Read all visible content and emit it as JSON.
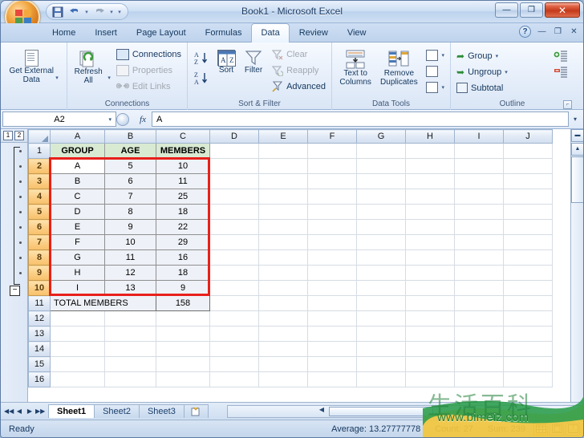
{
  "window": {
    "title": "Book1 - Microsoft Excel",
    "minimize_label": "—",
    "restore_label": "❐",
    "close_label": "✕"
  },
  "quick_access": {
    "office_button": "Office Button",
    "save_label": "💾",
    "undo_label": "↶",
    "redo_label": "↷",
    "customize_label": "▾"
  },
  "ribbon": {
    "tabs": [
      {
        "label": "Home",
        "active": false
      },
      {
        "label": "Insert",
        "active": false
      },
      {
        "label": "Page Layout",
        "active": false
      },
      {
        "label": "Formulas",
        "active": false
      },
      {
        "label": "Data",
        "active": true
      },
      {
        "label": "Review",
        "active": false
      },
      {
        "label": "View",
        "active": false
      }
    ],
    "help_label": "?",
    "doc_minimize": "—",
    "doc_restore": "❐",
    "doc_close": "✕",
    "groups": {
      "get_external": {
        "label": "",
        "button_line1": "Get External",
        "button_line2": "Data",
        "dropdown": "▾"
      },
      "connections": {
        "label": "Connections",
        "refresh_line1": "Refresh",
        "refresh_line2": "All",
        "refresh_dropdown": "▾",
        "connections_label": "Connections",
        "properties_label": "Properties",
        "edit_links_label": "Edit Links"
      },
      "sort_filter": {
        "label": "Sort & Filter",
        "sort_az_label": "A\nZ↓",
        "sort_za_label": "Z\nA↓",
        "sort_label": "Sort",
        "filter_label": "Filter",
        "clear_label": "Clear",
        "reapply_label": "Reapply",
        "advanced_label": "Advanced"
      },
      "data_tools": {
        "label": "Data Tools",
        "text_to_columns_line1": "Text to",
        "text_to_columns_line2": "Columns",
        "remove_duplicates_line1": "Remove",
        "remove_duplicates_line2": "Duplicates",
        "validation_dropdown": "▾",
        "whatif_dropdown": "▾"
      },
      "outline": {
        "label": "Outline",
        "group_label": "Group",
        "group_dropdown": "▾",
        "ungroup_label": "Ungroup",
        "ungroup_dropdown": "▾",
        "subtotal_label": "Subtotal",
        "launcher": "⌐"
      }
    }
  },
  "formula_bar": {
    "name_box_value": "A2",
    "name_box_caret": "▾",
    "fx_label": "fx",
    "formula_value": "A",
    "expand_caret": "▾"
  },
  "sheet": {
    "outline_levels": [
      "1",
      "2"
    ],
    "collapse_button": "−",
    "column_headers": [
      "A",
      "B",
      "C",
      "D",
      "E",
      "F",
      "G",
      "H",
      "I",
      "J"
    ],
    "selected_columns": [],
    "row_numbers": [
      "1",
      "2",
      "3",
      "4",
      "5",
      "6",
      "7",
      "8",
      "9",
      "10",
      "11",
      "12",
      "13",
      "14",
      "15",
      "16"
    ],
    "selected_rows": [
      "2",
      "3",
      "4",
      "5",
      "6",
      "7",
      "8",
      "9",
      "10"
    ],
    "header_row": {
      "a": "GROUP",
      "b": "AGE",
      "c": "MEMBERS"
    },
    "rows": [
      {
        "row": "2",
        "group": "A",
        "age": "5",
        "members": "10",
        "active": true
      },
      {
        "row": "3",
        "group": "B",
        "age": "6",
        "members": "11",
        "active": false
      },
      {
        "row": "4",
        "group": "C",
        "age": "7",
        "members": "25",
        "active": false
      },
      {
        "row": "5",
        "group": "D",
        "age": "8",
        "members": "18",
        "active": false
      },
      {
        "row": "6",
        "group": "E",
        "age": "9",
        "members": "22",
        "active": false
      },
      {
        "row": "7",
        "group": "F",
        "age": "10",
        "members": "29",
        "active": false
      },
      {
        "row": "8",
        "group": "G",
        "age": "11",
        "members": "16",
        "active": false
      },
      {
        "row": "9",
        "group": "H",
        "age": "12",
        "members": "18",
        "active": false
      },
      {
        "row": "10",
        "group": "I",
        "age": "13",
        "members": "9",
        "active": false
      }
    ],
    "total_row": {
      "row": "11",
      "label": "TOTAL MEMBERS",
      "value": "158"
    },
    "empty_rows": [
      "12",
      "13",
      "14",
      "15",
      "16"
    ],
    "selection_color": "#e8201b",
    "header_fill_color": "#d9ead3",
    "data_fill_color": "#eef1f7"
  },
  "sheet_tabs": {
    "nav_first": "◀◀",
    "nav_prev": "◀",
    "nav_next": "▶",
    "nav_last": "▶▶",
    "tabs": [
      {
        "label": "Sheet1",
        "active": true
      },
      {
        "label": "Sheet2",
        "active": false
      },
      {
        "label": "Sheet3",
        "active": false
      }
    ],
    "insert_tab_label": "",
    "split_handle": "◀"
  },
  "status_bar": {
    "mode": "Ready",
    "average": "Average: 13.27777778",
    "count": "Count: 27",
    "sum": "Sum: 239",
    "view_normal": "Normal",
    "view_layout": "Page Layout",
    "view_break": "Page Break Preview"
  },
  "watermark": {
    "url": "www.bimeiz.com",
    "cn_text": "生活百科"
  }
}
